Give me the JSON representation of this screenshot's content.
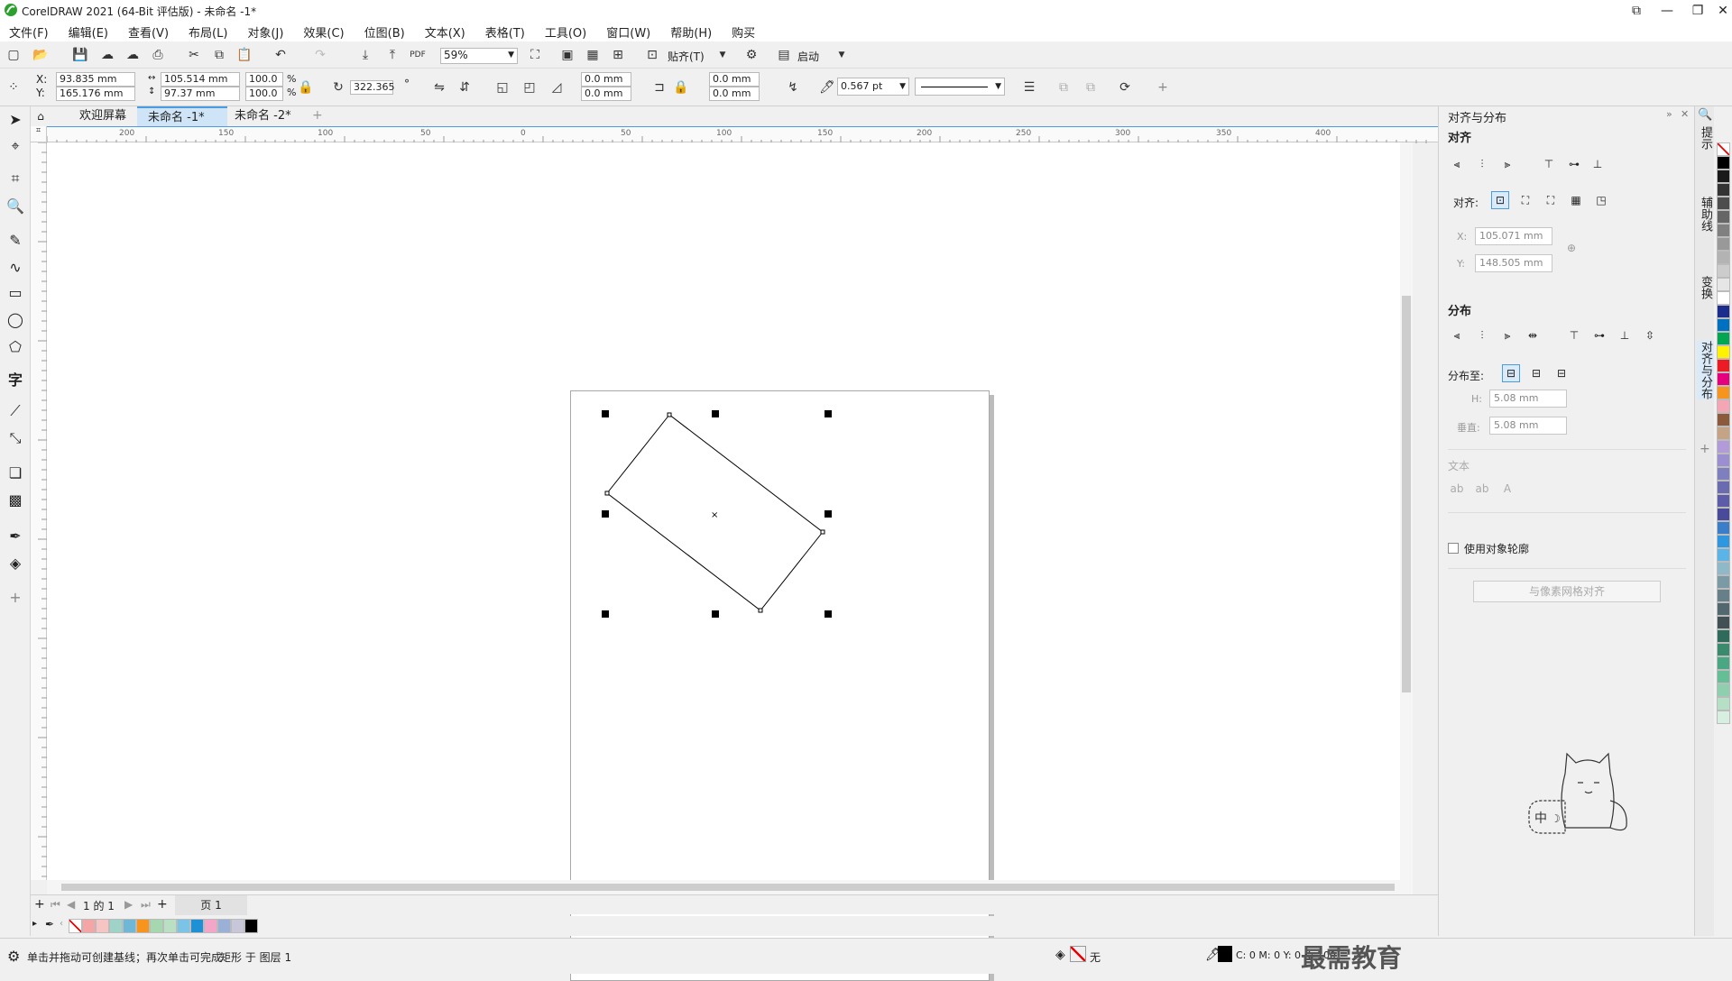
{
  "app": {
    "title": "CorelDRAW 2021 (64-Bit 评估版) - 未命名 -1*"
  },
  "menu": [
    "文件(F)",
    "编辑(E)",
    "查看(V)",
    "布局(L)",
    "对象(J)",
    "效果(C)",
    "位图(B)",
    "文本(X)",
    "表格(T)",
    "工具(O)",
    "窗口(W)",
    "帮助(H)",
    "购买"
  ],
  "toolbar": {
    "zoom": "59%",
    "snap_label": "贴齐(T)",
    "launch_label": "启动",
    "pdf_label": "PDF"
  },
  "props": {
    "x_label": "X:",
    "y_label": "Y:",
    "x": "93.835 mm",
    "y": "165.176 mm",
    "w": "105.514 mm",
    "h": "97.37 mm",
    "sx": "100.0",
    "sy": "100.0",
    "pct": "%",
    "rotation": "322.365",
    "deg": "°",
    "corner1": "0.0 mm",
    "corner2": "0.0 mm",
    "corner3": "0.0 mm",
    "corner4": "0.0 mm",
    "outline": "0.567 pt"
  },
  "tabs": [
    "欢迎屏幕",
    "未命名 -1*",
    "未命名 -2*"
  ],
  "ruler": {
    "h_ticks": [
      "200",
      "150",
      "100",
      "50",
      "0",
      "50",
      "100",
      "150",
      "200",
      "250",
      "300",
      "350",
      "400"
    ]
  },
  "docker": {
    "title": "对齐与分布",
    "align_heading": "对齐",
    "align_to_label": "对齐:",
    "x_label": "X:",
    "y_label": "Y:",
    "x_value": "105.071 mm",
    "y_value": "148.505 mm",
    "distribute_heading": "分布",
    "distribute_to_label": "分布至:",
    "h_label": "H:",
    "v_label": "垂直:",
    "h_value": "5.08 mm",
    "v_value": "5.08 mm",
    "text_heading": "文本",
    "use_outline_label": "使用对象轮廓",
    "pixel_grid_button": "与像素网格对齐"
  },
  "side_tabs": [
    "提示",
    "辅助线",
    "变换",
    "对齐与分布"
  ],
  "pagebar": {
    "page_count": "1 的 1",
    "page_tab": "页 1"
  },
  "status": {
    "hint": "单击并拖动可创建基线；再次单击可完成",
    "object": "矩形 于 图层 1",
    "fill": "无",
    "cmyk": "C: 0 M: 0 Y: 0 K: 100"
  },
  "watermark": "最需教育",
  "palette_colors": [
    "#ffffff",
    "#000000",
    "#1a1a1a",
    "#333333",
    "#4d4d4d",
    "#666666",
    "#808080",
    "#999999",
    "#b3b3b3",
    "#cccccc",
    "#e6e6e6",
    "#ffffff",
    "#1c2c8c",
    "#0070c0",
    "#00a651",
    "#fff200",
    "#ed1c24",
    "#e6007e",
    "#f7941d",
    "#f4a6b5",
    "#8b5a3c",
    "#c4a484",
    "#b19cd9",
    "#9b8fd1",
    "#7f7fbf",
    "#6b6bb0",
    "#5c5ca8",
    "#4a4a9a",
    "#3a7dc9",
    "#2f96e0",
    "#5ab4e8",
    "#8fb9c8",
    "#7a9aa5",
    "#667f88",
    "#53676e",
    "#405055",
    "#2f6b5a",
    "#3a8a6e",
    "#49a883",
    "#64bf97",
    "#8dcfae",
    "#b5e0c6",
    "#d7efe0"
  ],
  "doc_palette": [
    "#ffffff",
    "#f4a6a6",
    "#f7c4c4",
    "#9fd3c7",
    "#6fb7d6",
    "#f7941d",
    "#a6d8b0",
    "#b9e0c2",
    "#7bc4e8",
    "#1e90d6",
    "#f4a6c8",
    "#9bb0d6",
    "#c7c7d9",
    "#000000"
  ]
}
